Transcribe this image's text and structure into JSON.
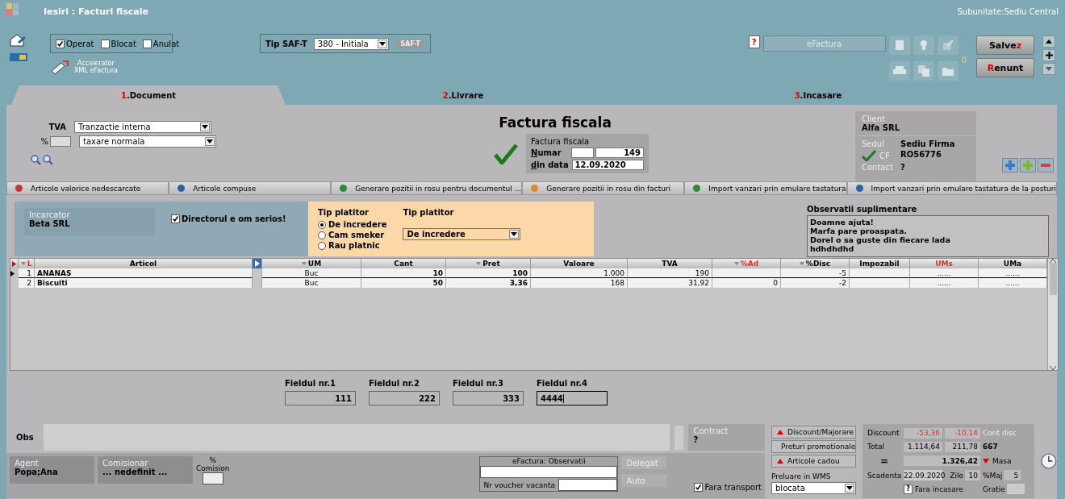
{
  "window": {
    "title": "Iesiri : Facturi fiscale",
    "subunit": "Subunitate:Sediu Central"
  },
  "status_checks": [
    {
      "label": "Operat",
      "checked": true
    },
    {
      "label": "Blocat",
      "checked": false
    },
    {
      "label": "Anulat",
      "checked": false
    }
  ],
  "accelerator": {
    "line_1": "Accelerator",
    "line_2": "XML eFactura"
  },
  "saft": {
    "label": "Tip SAF-T",
    "value": "380 - Initiala",
    "badge": "SAF-T"
  },
  "efactura": {
    "help": "?",
    "button": "eFactura",
    "count": "0"
  },
  "actions": [
    {
      "parts": [
        {
          "text": "Salve",
          "hotkey": false
        },
        {
          "text": "z",
          "hotkey": true
        }
      ]
    },
    {
      "parts": [
        {
          "text": "R",
          "hotkey": true
        },
        {
          "text": "enunt",
          "hotkey": false
        }
      ]
    }
  ],
  "tabs": [
    {
      "number": "1",
      "label": ".Document",
      "selected": true
    },
    {
      "number": "2",
      "label": ".Livrare",
      "selected": false
    },
    {
      "number": "3",
      "label": ".Incasare",
      "selected": false
    }
  ],
  "tva": {
    "label": "TVA",
    "percent_label": "%",
    "type": "Tranzactie interna",
    "regime": "taxare normala"
  },
  "document": {
    "heading": "Factura fiscala",
    "box_title": "Factura fiscala",
    "number_label": "Numar",
    "number": "149",
    "date_label": "din data",
    "date": "12.09.2020"
  },
  "client": {
    "label": "Client",
    "name": "Alfa SRL",
    "seat_label": "Sedul",
    "seat": "Sediu Firma",
    "cf_label": "CF",
    "cf": "RO56776",
    "contact_label": "Contact",
    "contact": "?"
  },
  "toolbar_buttons": [
    {
      "label": "Articole valorice nedescarcate",
      "color": "#c0392b"
    },
    {
      "label": "Articole compuse",
      "color": "#2e5fa8"
    },
    {
      "label": "Generare pozitii in rosu pentru documentul ...",
      "color": "#2e8b3e"
    },
    {
      "label": "Generare pozitii in rosu din facturi",
      "color": "#e08a2a"
    },
    {
      "label": "Import vanzari prin emulare tastatura",
      "color": "#2e8b3e"
    },
    {
      "label": "Import vanzari prin emulare tastatura de la posturi",
      "color": "#2e5fa8"
    }
  ],
  "loader": {
    "label": "Incarcator",
    "value": "Beta SRL"
  },
  "director_check": {
    "label": "Directorul e om serios!",
    "checked": true
  },
  "payer": {
    "radio_title": "Tip platitor",
    "options": [
      {
        "label": "De incredere",
        "selected": true
      },
      {
        "label": "Cam smeker",
        "selected": false
      },
      {
        "label": "Rau platnic",
        "selected": false
      }
    ],
    "select_label": "Tip platitor",
    "select_value": "De incredere"
  },
  "notes": {
    "label": "Observatii suplimentare",
    "lines": [
      "Doamne ajuta!",
      "Marfa pare proaspata.",
      "Dorel o sa guste din fiecare lada",
      "hdhdhdhd"
    ]
  },
  "table": {
    "columns": [
      {
        "label": "L",
        "highlighted": true,
        "sortable": true
      },
      {
        "label": "Articol",
        "highlighted": false,
        "sortable": false
      },
      {
        "label": "UM",
        "highlighted": false,
        "sortable": true
      },
      {
        "label": "Cant",
        "highlighted": false,
        "sortable": false
      },
      {
        "label": "Pret",
        "highlighted": false,
        "sortable": true
      },
      {
        "label": "Valoare",
        "highlighted": false,
        "sortable": false
      },
      {
        "label": "TVA",
        "highlighted": false,
        "sortable": false
      },
      {
        "label": "%Ad",
        "highlighted": true,
        "sortable": true
      },
      {
        "label": "%Disc",
        "highlighted": false,
        "sortable": true
      },
      {
        "label": "Impozabil",
        "highlighted": false,
        "sortable": false
      },
      {
        "label": "UMs",
        "highlighted": true,
        "sortable": false
      },
      {
        "label": "UMa",
        "highlighted": false,
        "sortable": false
      }
    ],
    "rows": [
      {
        "current": true,
        "nr": "1",
        "articol": "ANANAS",
        "um": "Buc",
        "cant": "10",
        "pret": "100",
        "valoare": "1.000",
        "tva": "190",
        "disc": "-5",
        "ums": "......",
        "uma": "......"
      },
      {
        "current": false,
        "nr": "2",
        "articol": "Biscuiti",
        "um": "Buc",
        "cant": "50",
        "pret": "3,36",
        "valoare": "168",
        "tva": "31,92",
        "ad": "0",
        "disc": "-2",
        "ums": "......",
        "uma": "......"
      }
    ]
  },
  "custom_fields": [
    {
      "label": "Fieldul nr.1",
      "value": "111",
      "focused": false
    },
    {
      "label": "Fieldul nr.2",
      "value": "222",
      "focused": false
    },
    {
      "label": "Fieldul nr.3",
      "value": "333",
      "focused": false
    },
    {
      "label": "Fieldul nr.4",
      "value": "4444",
      "focused": true
    }
  ],
  "obs": {
    "label": "Obs"
  },
  "contract": {
    "label": "Contract",
    "value": "?"
  },
  "price_buttons": [
    "Discount/Majorare",
    "Preturi promotionale",
    "Articole cadou"
  ],
  "wms": {
    "label": "Preluare in WMS",
    "value": "blocata"
  },
  "totals": {
    "discount_label": "Discount",
    "discount": [
      "-53,36",
      "-10,14"
    ],
    "total_label": "Total",
    "total": [
      "1.114,64",
      "211,78"
    ],
    "equals": "=",
    "grand_total": "1.326,42",
    "cont_disc_label": "Cont disc",
    "cont_disc": "667",
    "masa_label": "Masa",
    "scadenta_label": "Scadenta",
    "scadenta": "22.09.2020",
    "zile_label": "Zile",
    "zile": "10",
    "maj_label": "%Maj",
    "maj": "5",
    "no_payment_help": "?",
    "no_payment_label": "Fara incasare",
    "gratie_label": "Gratie"
  },
  "agent": {
    "label": "Agent",
    "value": "Popa;Ana"
  },
  "commissioner": {
    "label": "Comisionar",
    "value": "... nedefinit ..."
  },
  "commission": {
    "label_1": "%",
    "label_2": "Comision"
  },
  "efactura_notes": {
    "label": "eFactura: Observatii",
    "voucher_label": "Nr voucher vacanta"
  },
  "delegate": {
    "label": "Delegat"
  },
  "auto": {
    "label": "Auto"
  },
  "transport": {
    "label": "Fara transport",
    "checked": true
  }
}
